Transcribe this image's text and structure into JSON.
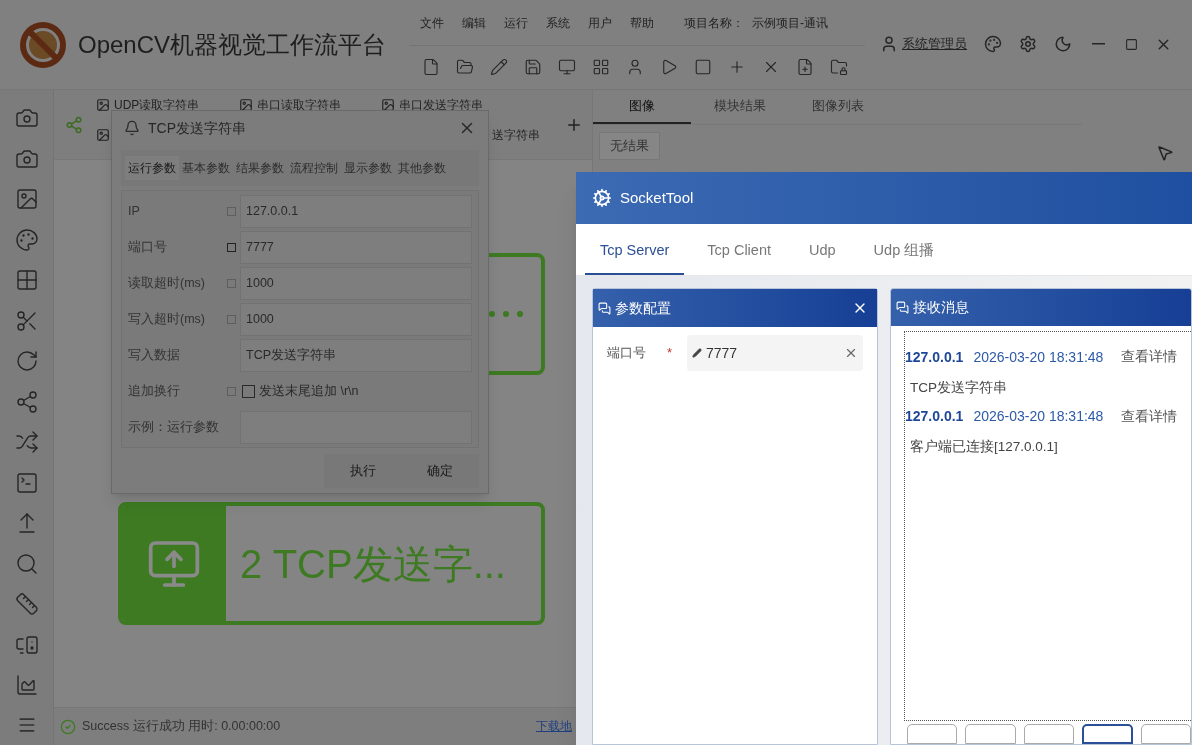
{
  "app": {
    "title": "OpenCV机器视觉工作流平台",
    "menu": [
      "文件",
      "编辑",
      "运行",
      "系统",
      "用户",
      "帮助"
    ],
    "project_label": "项目名称：",
    "project_name": "示例项目-通讯",
    "user": "系统管理员"
  },
  "module_tabs": [
    {
      "label": "UDP读取字符串"
    },
    {
      "label": "串口读取字符串"
    },
    {
      "label": "串口发送字符串"
    }
  ],
  "module_tab_partial": "送字符串",
  "nodes": [
    {
      "label": "2 TCP发送字...",
      "active": true
    }
  ],
  "result_tabs": [
    {
      "label": "图像",
      "selected": true
    },
    {
      "label": "模块结果",
      "selected": false
    },
    {
      "label": "图像列表",
      "selected": false
    }
  ],
  "result_button": "无结果",
  "status": {
    "text": "Success 运行成功 用时: 0.00:00:00",
    "link": "下载地"
  },
  "dialog": {
    "title": "TCP发送字符串",
    "tabs": [
      {
        "label": "运行参数",
        "selected": true
      },
      {
        "label": "基本参数",
        "selected": false
      },
      {
        "label": "结果参数",
        "selected": false
      },
      {
        "label": "流程控制",
        "selected": false
      },
      {
        "label": "显示参数",
        "selected": false
      },
      {
        "label": "其他参数",
        "selected": false
      }
    ],
    "params": [
      {
        "kind": "field",
        "label": "IP",
        "linked": false,
        "value": "127.0.0.1"
      },
      {
        "kind": "field",
        "label": "端口号",
        "linked": true,
        "value": "7777"
      },
      {
        "kind": "field",
        "label": "读取超时(ms)",
        "linked": false,
        "value": "1000"
      },
      {
        "kind": "field",
        "label": "写入超时(ms)",
        "linked": false,
        "value": "1000"
      },
      {
        "kind": "field",
        "label": "写入数据",
        "value": "TCP发送字符串"
      },
      {
        "kind": "checkbox",
        "label": "追加换行",
        "linked": false,
        "checked": false,
        "text": "发送末尾追加 \\r\\n"
      },
      {
        "kind": "field",
        "label": "示例：运行参数"
      }
    ],
    "buttons": [
      "执行",
      "确定"
    ]
  },
  "socket_tool": {
    "title": "SocketTool",
    "tabs": [
      {
        "label": "Tcp Server",
        "selected": true
      },
      {
        "label": "Tcp Client",
        "selected": false
      },
      {
        "label": "Udp",
        "selected": false
      },
      {
        "label": "Udp 组播",
        "selected": false
      }
    ],
    "config": {
      "title": "参数配置",
      "port_label": "端口号",
      "required_mark": "*",
      "port_value": "7777"
    },
    "messages_panel": {
      "title": "接收消息",
      "messages": [
        {
          "ip": "127.0.0.1",
          "time": "2026-03-20 18:31:48",
          "action": "查看详情",
          "body": "TCP发送字符串"
        },
        {
          "ip": "127.0.0.1",
          "time": "2026-03-20 18:31:48",
          "action": "查看详情",
          "body": "客户端已连接[127.0.0.1]"
        }
      ],
      "footer_buttons": [
        {
          "selected": false
        },
        {
          "selected": false
        },
        {
          "selected": false
        },
        {
          "selected": true
        },
        {
          "selected": false
        }
      ]
    }
  }
}
